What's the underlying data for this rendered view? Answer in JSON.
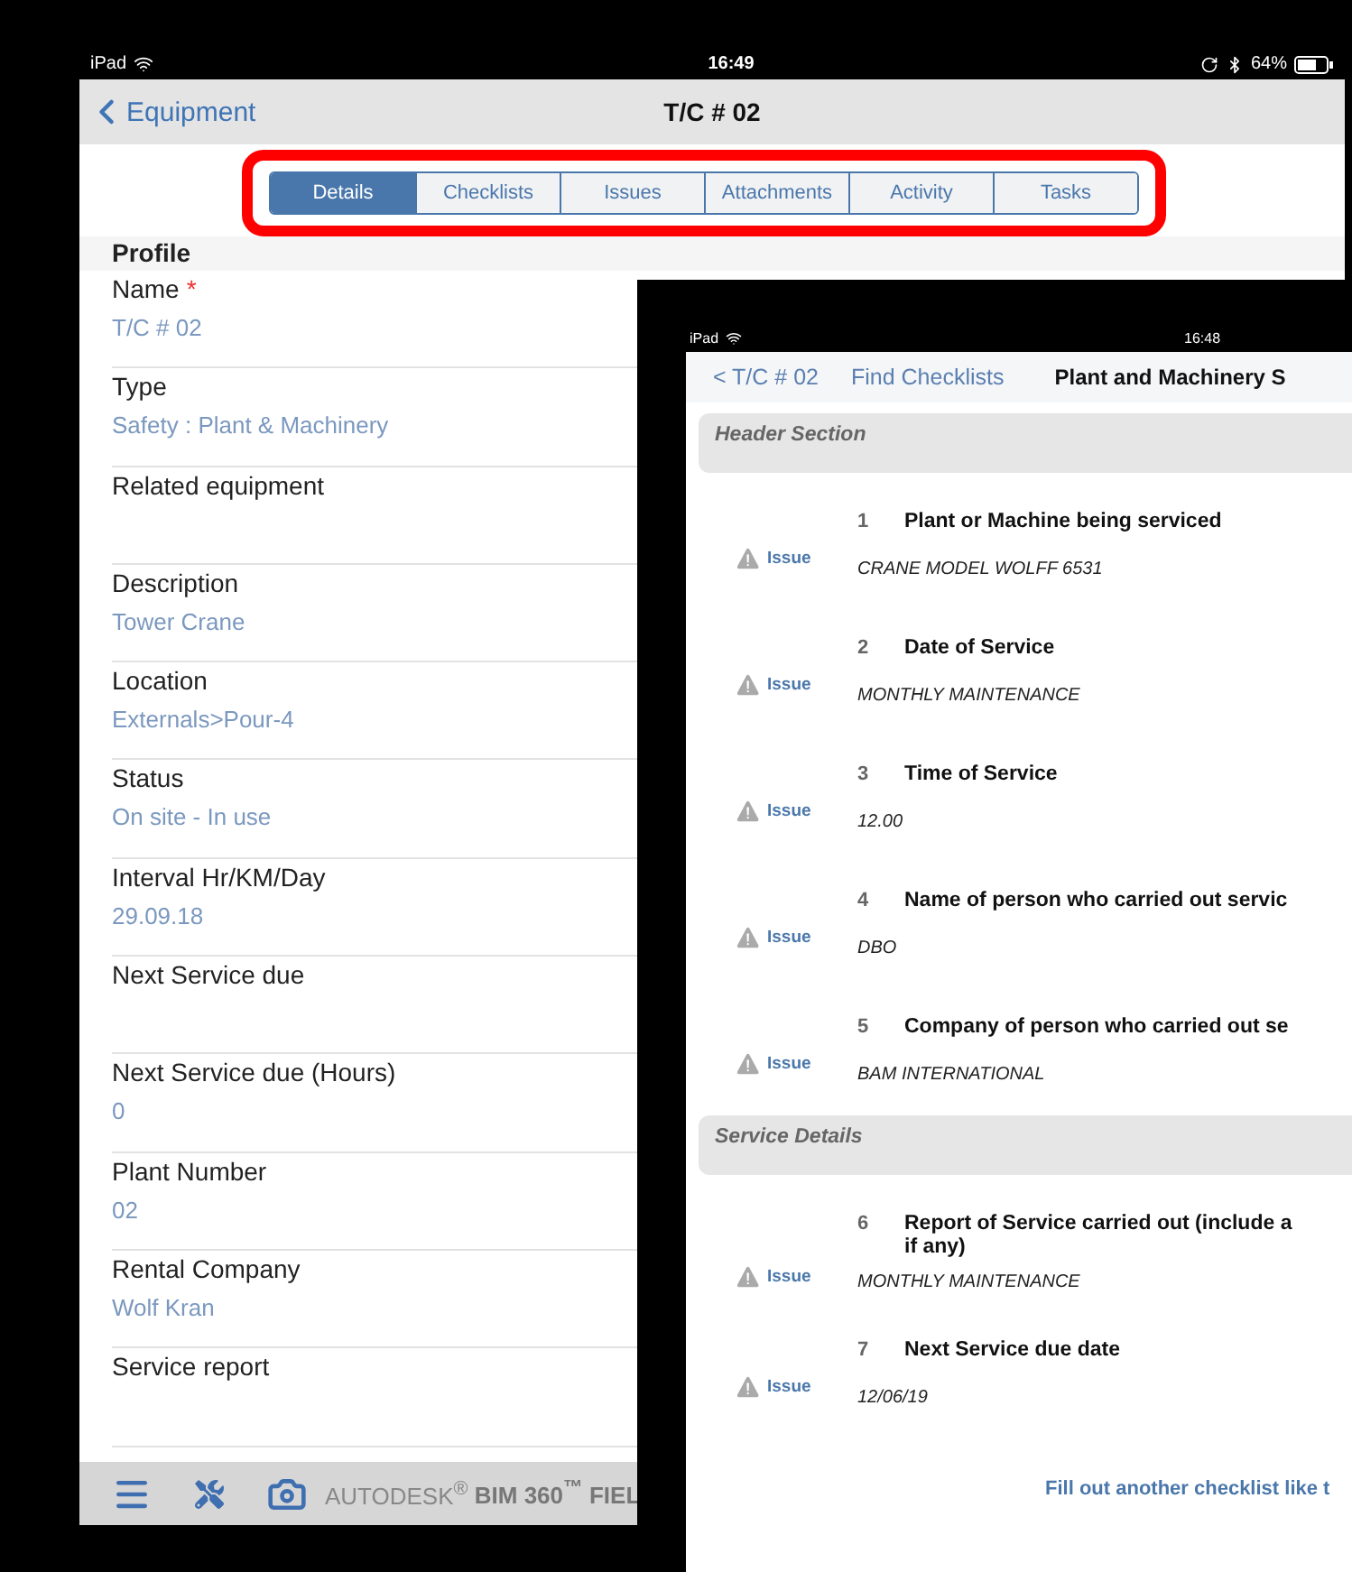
{
  "main_screen": {
    "status_bar": {
      "device": "iPad",
      "time": "16:49",
      "battery": "64%"
    },
    "nav": {
      "back": "Equipment",
      "title": "T/C # 02"
    },
    "tabs": [
      {
        "label": "Details",
        "selected": true
      },
      {
        "label": "Checklists",
        "selected": false
      },
      {
        "label": "Issues",
        "selected": false
      },
      {
        "label": "Attachments",
        "selected": false
      },
      {
        "label": "Activity",
        "selected": false
      },
      {
        "label": "Tasks",
        "selected": false
      }
    ],
    "section": "Profile",
    "fields": [
      {
        "label": "Name",
        "marker": "*",
        "value": "T/C # 02"
      },
      {
        "label": "Type",
        "value": "Safety : Plant & Machinery"
      },
      {
        "label": "Related equipment"
      },
      {
        "label": "Description",
        "value": "Tower Crane"
      },
      {
        "label": "Location",
        "value": "Externals>Pour-4"
      },
      {
        "label": "Status",
        "value": "On site - In use"
      },
      {
        "label": "Interval Hr/KM/Day",
        "value": "29.09.18"
      },
      {
        "label": "Next Service due"
      },
      {
        "label": "Next Service due (Hours)",
        "value": "0"
      },
      {
        "label": "Plant Number",
        "value": "02"
      },
      {
        "label": "Rental Company",
        "value": "Wolf Kran"
      },
      {
        "label": "Service report"
      }
    ],
    "toolbar": {
      "brand": "AUTODESK$^{®}$ **BIM 360$^{™}$ FIEL**"
    }
  },
  "checklist_screen": {
    "status_bar": {
      "device": "iPad",
      "time": "16:48"
    },
    "nav": {
      "back": "< T/C # 02",
      "link": "Find Checklists",
      "title": "Plant and Machinery S"
    },
    "sections": [
      {
        "title": "Header Section",
        "items": [
          {
            "number": "1",
            "title": "Plant or Machine being serviced",
            "answer": "CRANE MODEL WOLFF 6531",
            "issue": "Issue"
          },
          {
            "number": "2",
            "title": "Date of Service",
            "answer": "MONTHLY MAINTENANCE",
            "issue": "Issue"
          },
          {
            "number": "3",
            "title": "Time of Service",
            "answer": "12.00",
            "issue": "Issue"
          },
          {
            "number": "4",
            "title": "Name of person who carried out servic",
            "answer": "DBO",
            "issue": "Issue"
          },
          {
            "number": "5",
            "title": "Company of person who carried out se",
            "answer": "BAM INTERNATIONAL",
            "issue": "Issue"
          }
        ]
      },
      {
        "title": "Service Details",
        "items": [
          {
            "number": "6",
            "title": "Report of Service carried out (include a\nif any)",
            "answer": "MONTHLY MAINTENANCE",
            "issue": "Issue"
          },
          {
            "number": "7",
            "title": "Next Service due date",
            "answer": "12/06/19",
            "issue": "Issue"
          }
        ]
      }
    ],
    "footer_link": "Fill out another checklist like t"
  }
}
